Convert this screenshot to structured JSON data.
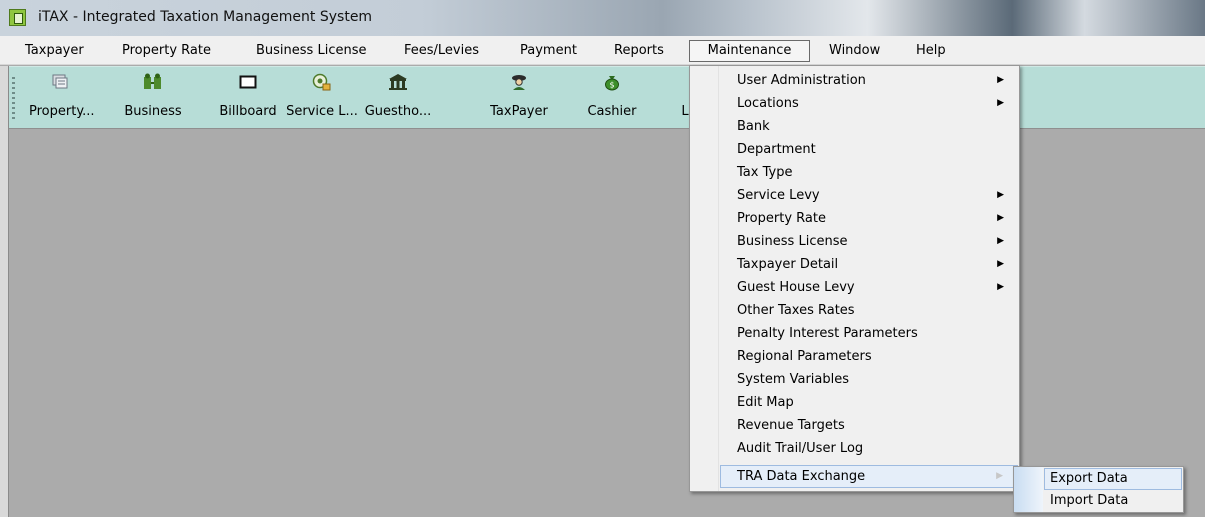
{
  "window": {
    "title": "iTAX - Integrated Taxation Management System"
  },
  "menubar": {
    "items": [
      {
        "label": "Taxpayer"
      },
      {
        "label": "Property Rate"
      },
      {
        "label": "Business License"
      },
      {
        "label": "Fees/Levies"
      },
      {
        "label": "Payment"
      },
      {
        "label": "Reports"
      },
      {
        "label": "Maintenance"
      },
      {
        "label": "Window"
      },
      {
        "label": "Help"
      }
    ],
    "active": "Maintenance"
  },
  "toolbar": {
    "buttons": [
      {
        "label": "Property...",
        "icon": "property-icon"
      },
      {
        "label": "Business",
        "icon": "business-icon"
      },
      {
        "label": "Billboard",
        "icon": "billboard-icon"
      },
      {
        "label": "Service L...",
        "icon": "service-levy-icon"
      },
      {
        "label": "Guestho...",
        "icon": "guesthouse-icon"
      },
      {
        "label": "TaxPayer",
        "icon": "taxpayer-icon"
      },
      {
        "label": "Cashier",
        "icon": "cashier-icon"
      },
      {
        "label": "L",
        "icon": ""
      }
    ],
    "background": "#b7ddd7"
  },
  "maintenance_menu": {
    "items": [
      {
        "label": "User Administration",
        "submenu": true
      },
      {
        "label": "Locations",
        "submenu": true
      },
      {
        "label": "Bank",
        "submenu": false
      },
      {
        "label": "Department",
        "submenu": false
      },
      {
        "label": "Tax Type",
        "submenu": false
      },
      {
        "label": "Service Levy",
        "submenu": true
      },
      {
        "label": "Property Rate",
        "submenu": true
      },
      {
        "label": "Business License",
        "submenu": true
      },
      {
        "label": "Taxpayer Detail",
        "submenu": true
      },
      {
        "label": "Guest House Levy",
        "submenu": true
      },
      {
        "label": "Other Taxes Rates",
        "submenu": false
      },
      {
        "label": "Penalty Interest Parameters",
        "submenu": false
      },
      {
        "label": "Regional Parameters",
        "submenu": false
      },
      {
        "label": "System Variables",
        "submenu": false
      },
      {
        "label": "Edit Map",
        "submenu": false
      },
      {
        "label": "Revenue Targets",
        "submenu": false
      },
      {
        "label": "Audit Trail/User Log",
        "submenu": false
      },
      {
        "label": "TRA Data Exchange",
        "submenu": true
      }
    ],
    "highlighted": "TRA Data Exchange"
  },
  "tra_submenu": {
    "items": [
      {
        "label": "Export Data"
      },
      {
        "label": "Import Data"
      }
    ],
    "highlighted": "Export Data"
  },
  "colors": {
    "workspace": "#ababab",
    "highlight": "#e5eef9",
    "highlight_border": "#9ebbe0"
  }
}
